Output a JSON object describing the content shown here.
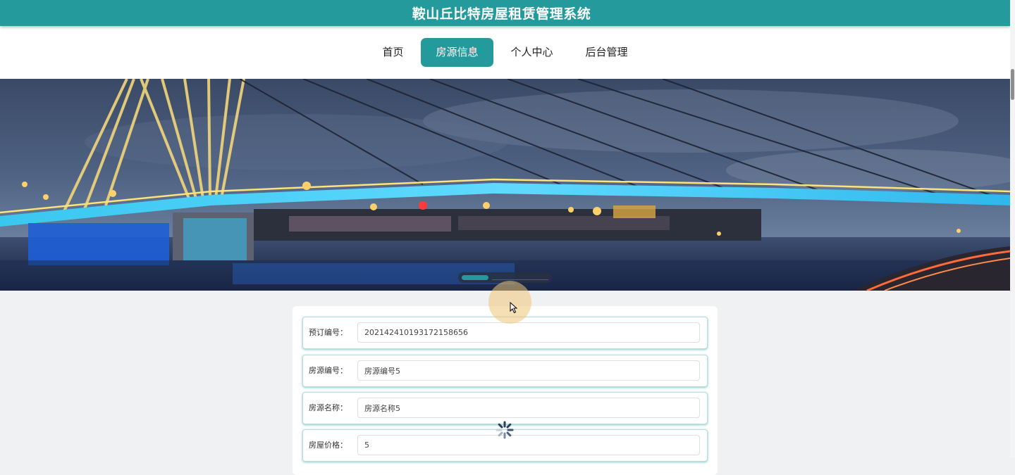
{
  "header": {
    "title": "鞍山丘比特房屋租赁管理系统"
  },
  "nav": {
    "items": [
      {
        "label": "首页",
        "active": false
      },
      {
        "label": "房源信息",
        "active": true
      },
      {
        "label": "个人中心",
        "active": false
      },
      {
        "label": "后台管理",
        "active": false
      }
    ]
  },
  "carousel": {
    "active_index": 0,
    "icons": [
      "night-bridge-photo"
    ]
  },
  "form": {
    "fields": [
      {
        "label": "预订编号：",
        "value": "202142410193172158656"
      },
      {
        "label": "房源编号：",
        "value": "房源编号5"
      },
      {
        "label": "房源名称：",
        "value": "房源名称5"
      },
      {
        "label": "房屋价格：",
        "value": "5"
      }
    ]
  },
  "colors": {
    "accent": "#259a9c",
    "page_bg": "#f0f1f3"
  }
}
